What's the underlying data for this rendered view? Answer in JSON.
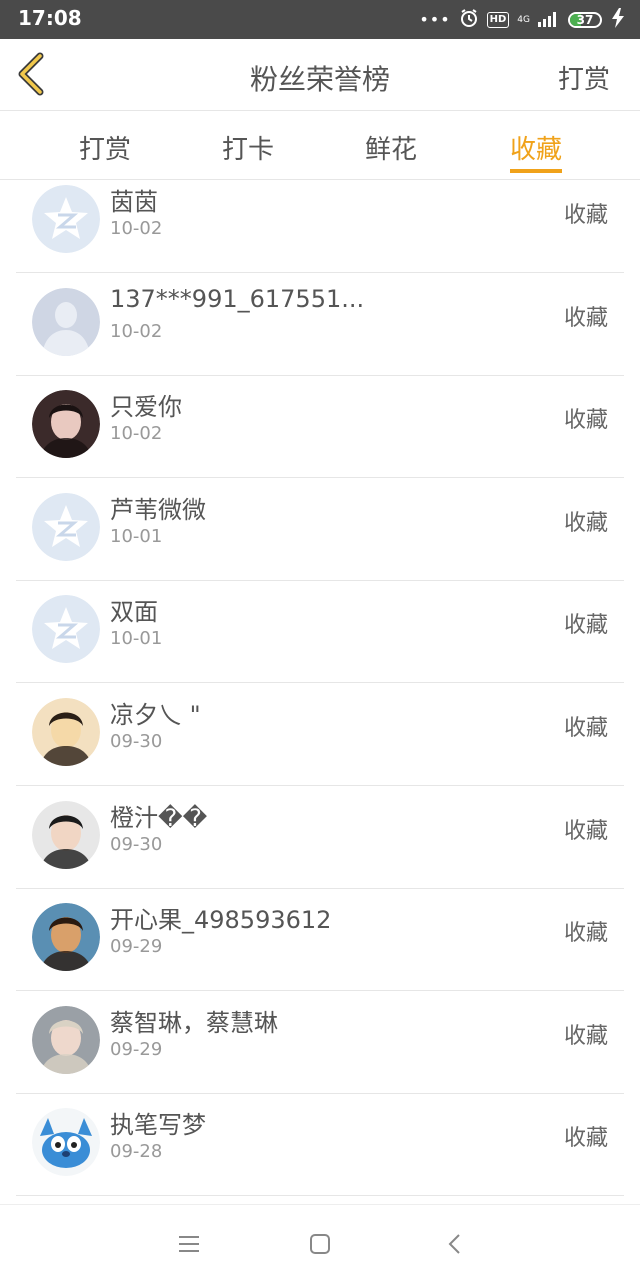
{
  "status_bar": {
    "time": "17:08",
    "dots": "•••",
    "hd_label": "HD",
    "network": "4G",
    "battery_level": "37",
    "icons": [
      "alarm-icon",
      "signal-icon",
      "battery-icon",
      "charging-icon"
    ]
  },
  "header": {
    "title": "粉丝荣誉榜",
    "action_label": "打赏"
  },
  "tabs": [
    {
      "label": "打赏",
      "active": false
    },
    {
      "label": "打卡",
      "active": false
    },
    {
      "label": "鲜花",
      "active": false
    },
    {
      "label": "收藏",
      "active": true
    }
  ],
  "accent_color": "#f0a21a",
  "items": [
    {
      "name": "茵茵",
      "date": "10-02",
      "action": "收藏",
      "avatar": "qzone-avatar"
    },
    {
      "name": "137***991_617551...",
      "date": "10-02",
      "action": "收藏",
      "avatar": "default-person-avatar"
    },
    {
      "name": "只爱你",
      "date": "10-02",
      "action": "收藏",
      "avatar": "photo-avatar"
    },
    {
      "name": "芦苇微微",
      "date": "10-01",
      "action": "收藏",
      "avatar": "qzone-avatar"
    },
    {
      "name": "双面",
      "date": "10-01",
      "action": "收藏",
      "avatar": "qzone-avatar"
    },
    {
      "name": "凉夕乀 \"",
      "date": "09-30",
      "action": "收藏",
      "avatar": "photo-avatar"
    },
    {
      "name": "橙汁��",
      "date": "09-30",
      "action": "收藏",
      "avatar": "photo-avatar"
    },
    {
      "name": "开心果_498593612",
      "date": "09-29",
      "action": "收藏",
      "avatar": "photo-avatar"
    },
    {
      "name": "蔡智琳，蔡慧琳",
      "date": "09-29",
      "action": "收藏",
      "avatar": "photo-avatar"
    },
    {
      "name": "执笔写梦",
      "date": "09-28",
      "action": "收藏",
      "avatar": "cartoon-avatar"
    }
  ],
  "bottom_nav": [
    "menu-icon",
    "home-icon",
    "back-icon"
  ]
}
